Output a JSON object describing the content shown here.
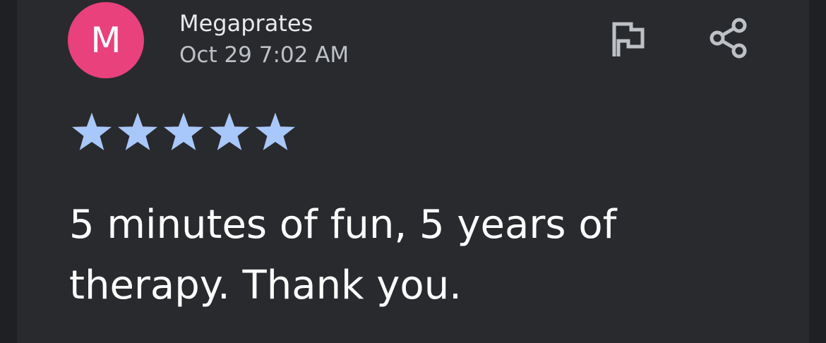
{
  "review": {
    "avatar_initial": "M",
    "author": "Megaprates",
    "timestamp": "Oct 29 7:02 AM",
    "rating": 5,
    "rating_max": 5,
    "text": "5 minutes of fun, 5 years of therapy. Thank you."
  },
  "actions": {
    "flag_icon": "flag-icon",
    "share_icon": "share-icon"
  },
  "colors": {
    "background": "#292a2d",
    "avatar": "#e8417c",
    "star": "#a8c7fa",
    "icon": "#bdc1c6"
  }
}
